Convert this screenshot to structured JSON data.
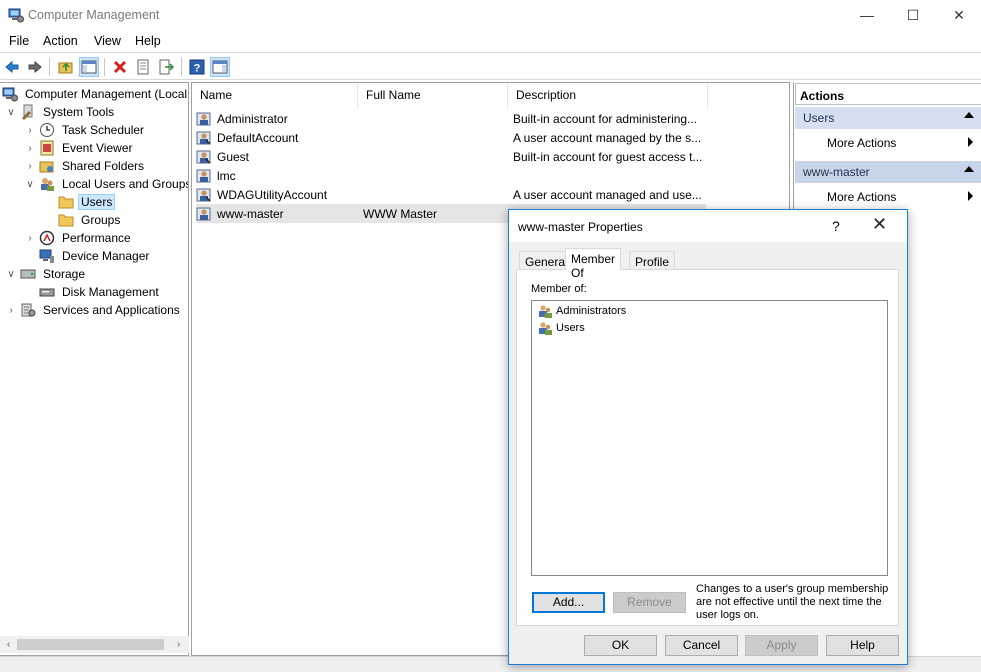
{
  "window": {
    "title": "Computer Management",
    "minimize": "—",
    "maximize": "☐",
    "close": "✕"
  },
  "menu": [
    "File",
    "Action",
    "View",
    "Help"
  ],
  "tree": {
    "items": [
      {
        "label": "Computer Management (Local",
        "icon": "computer-management-icon"
      },
      {
        "label": "System Tools",
        "icon": "system-tools-icon"
      },
      {
        "label": "Task Scheduler",
        "icon": "task-scheduler-icon"
      },
      {
        "label": "Event Viewer",
        "icon": "event-viewer-icon"
      },
      {
        "label": "Shared Folders",
        "icon": "shared-folders-icon"
      },
      {
        "label": "Local Users and Groups",
        "icon": "users-groups-icon"
      },
      {
        "label": "Users",
        "icon": "folder-icon"
      },
      {
        "label": "Groups",
        "icon": "folder-icon"
      },
      {
        "label": "Performance",
        "icon": "performance-icon"
      },
      {
        "label": "Device Manager",
        "icon": "device-manager-icon"
      },
      {
        "label": "Storage",
        "icon": "storage-icon"
      },
      {
        "label": "Disk Management",
        "icon": "disk-management-icon"
      },
      {
        "label": "Services and Applications",
        "icon": "services-icon"
      }
    ]
  },
  "list": {
    "columns": [
      "Name",
      "Full Name",
      "Description"
    ],
    "rows": [
      {
        "name": "Administrator",
        "full_name": "",
        "description": "Built-in account for administering..."
      },
      {
        "name": "DefaultAccount",
        "full_name": "",
        "description": "A user account managed by the s..."
      },
      {
        "name": "Guest",
        "full_name": "",
        "description": "Built-in account for guest access t..."
      },
      {
        "name": "lmc",
        "full_name": "",
        "description": ""
      },
      {
        "name": "WDAGUtilityAccount",
        "full_name": "",
        "description": "A user account managed and use..."
      },
      {
        "name": "www-master",
        "full_name": "WWW Master",
        "description": ""
      }
    ]
  },
  "actions": {
    "header": "Actions",
    "sections": [
      {
        "title": "Users",
        "item": "More Actions"
      },
      {
        "title": "www-master",
        "item": "More Actions"
      }
    ]
  },
  "dialog": {
    "title": "www-master Properties",
    "help": "?",
    "close": "✕",
    "tabs": [
      "General",
      "Member Of",
      "Profile"
    ],
    "active_tab": "Member Of",
    "member_of_label": "Member of:",
    "members": [
      "Administrators",
      "Users"
    ],
    "add_button": "Add...",
    "remove_button": "Remove",
    "note": "Changes to a user's group membership are not effective until the next time the user logs on.",
    "ok": "OK",
    "cancel": "Cancel",
    "apply": "Apply",
    "help_button": "Help"
  },
  "colors": {
    "selection": "#cce8ff",
    "actions_section": "#d4dff0",
    "dialog_border": "#1e7fd6"
  }
}
